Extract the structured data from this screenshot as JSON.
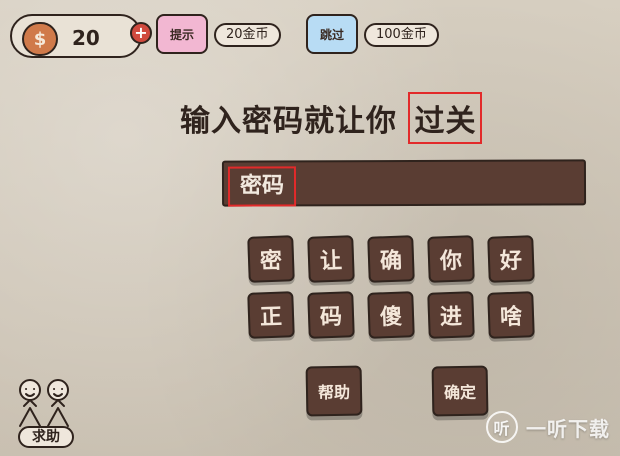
{
  "top_bar": {
    "coins": {
      "count": "20",
      "icon": "money-bag-icon",
      "plus_label": "+"
    },
    "hint": {
      "label": "提示",
      "price": "20金币",
      "shirt_color": "#f2b7d2"
    },
    "skip": {
      "label": "跳过",
      "price": "100金币",
      "shirt_color": "#b8dcf4"
    }
  },
  "prompt": {
    "text_prefix": "输入密码就让你",
    "text_highlight": "过关",
    "highlight_color": "#e22a2a"
  },
  "password": {
    "value": "密码",
    "highlight_color": "#e22a2a"
  },
  "tiles": {
    "row1": [
      "密",
      "让",
      "确",
      "你",
      "好"
    ],
    "row2": [
      "正",
      "码",
      "傻",
      "进",
      "啥"
    ]
  },
  "buttons": {
    "help": "帮助",
    "confirm": "确定"
  },
  "bottom_left": {
    "label": "求助"
  },
  "watermark": {
    "icon_text": "听",
    "text": "一听下载"
  },
  "colors": {
    "tile_brown": "#5a3d33",
    "outline": "#2f231d",
    "paper_bg": "#d7cfc1"
  }
}
